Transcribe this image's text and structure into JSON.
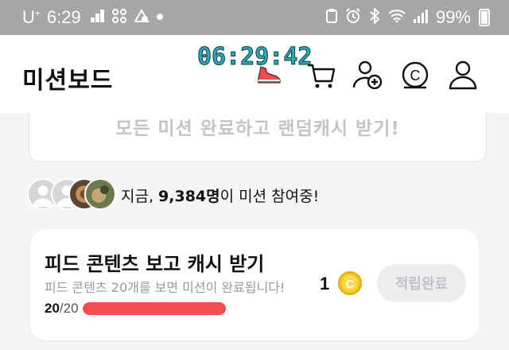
{
  "status_bar": {
    "carrier": "U",
    "carrier_sup": "+",
    "time": "6:29",
    "battery_percent": "99%",
    "battery_level": 0.99,
    "left_icons": [
      "signal-bars-icon",
      "grid-icon",
      "nav-icon",
      "dot-icon"
    ],
    "right_icons": [
      "clipboard-icon",
      "alarm-icon",
      "bluetooth-icon",
      "wifi-icon",
      "cell-signal-icon",
      "battery-icon"
    ]
  },
  "header": {
    "title": "미션보드",
    "timer": "06:29:42",
    "icons": [
      "cart-icon",
      "add-friend-icon",
      "cash-icon",
      "profile-icon"
    ]
  },
  "all_mission": {
    "label": "모든 미션 완료하고 랜덤캐시 받기!"
  },
  "participants": {
    "prefix": "지금, ",
    "count": "9,384명",
    "suffix": "이 미션 참여중!"
  },
  "mission": {
    "title": "피드 콘텐츠 보고 캐시 받기",
    "description": "피드 콘텐츠 20개를 보면 미션이 완료됩니다!",
    "reward": "1",
    "claim_label": "적립완료",
    "progress_current": "20",
    "progress_total": "/20",
    "progress_fraction": 1.0
  },
  "colors": {
    "accent_red": "#f24d4f",
    "timer_teal": "#2fa5b5",
    "coin_gold": "#f5c518",
    "statusbar_gray": "#a6a6a6"
  }
}
